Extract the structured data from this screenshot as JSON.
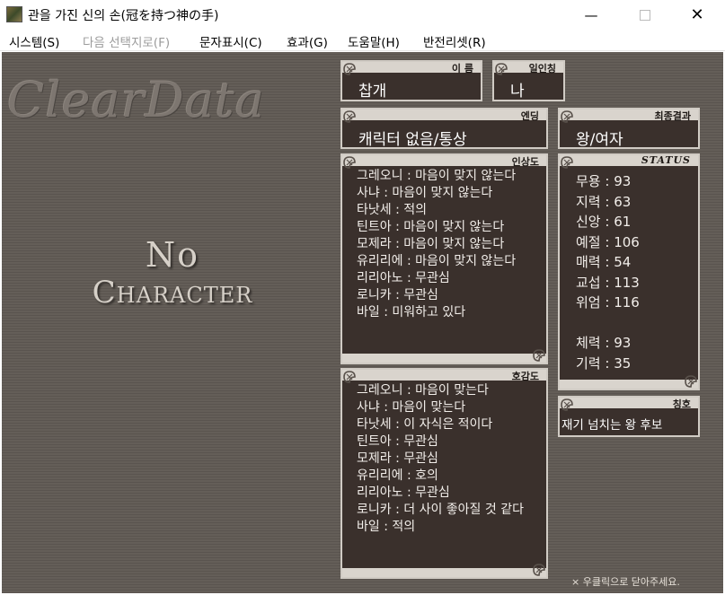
{
  "window": {
    "title": "관을 가진 신의 손(冠を持つ神の手)",
    "minimize": "—",
    "close": "✕"
  },
  "menu": [
    {
      "label": "시스템(S)",
      "enabled": true
    },
    {
      "label": "다음 선택지로(F)",
      "enabled": false
    },
    {
      "label": "문자표시(C)",
      "enabled": true
    },
    {
      "label": "효과(G)",
      "enabled": true
    },
    {
      "label": "도움말(H)",
      "enabled": true
    },
    {
      "label": "반전리셋(R)",
      "enabled": true
    }
  ],
  "logo": "ClearData",
  "portrait": {
    "line1": "No",
    "line2": "Character"
  },
  "name": {
    "label": "이 름",
    "value": "찹개"
  },
  "pronoun": {
    "label": "일인칭",
    "value": "나"
  },
  "ending": {
    "label": "엔딩",
    "value": "캐릭터 없음/통상"
  },
  "final_result": {
    "label": "최종결과",
    "value": "왕/여자"
  },
  "impression": {
    "label": "인상도",
    "items": [
      "그레오니 : 마음이 맞지 않는다",
      "사냐 : 마음이 맞지 않는다",
      "타낫세 : 적의",
      "틴트아 : 마음이 맞지 않는다",
      "모제라 : 마음이 맞지 않는다",
      "유리리에 : 마음이 맞지 않는다",
      "리리아노 : 무관심",
      "로니카 : 무관심",
      "바일 : 미워하고 있다"
    ]
  },
  "affection": {
    "label": "호감도",
    "items": [
      "그레오니 : 마음이 맞는다",
      "사냐 : 마음이 맞는다",
      "타낫세 : 이 자식은 적이다",
      "틴트아 : 무관심",
      "모제라 : 무관심",
      "유리리에 : 호의",
      "리리아노 : 무관심",
      "로니카 : 더 사이 좋아질 것 같다",
      "바일 : 적의"
    ]
  },
  "status": {
    "label": "STATUS",
    "items": [
      "무용 : 93",
      "지력 : 63",
      "신앙 : 61",
      "예절 : 106",
      "매력 : 54",
      "교섭 : 113",
      "위엄 : 116",
      "",
      "체력 : 93",
      "기력 : 35"
    ]
  },
  "title_panel": {
    "label": "칭호",
    "value": "재기 넘치는 왕 후보"
  },
  "footnote": "× 우클릭으로 닫아주세요."
}
